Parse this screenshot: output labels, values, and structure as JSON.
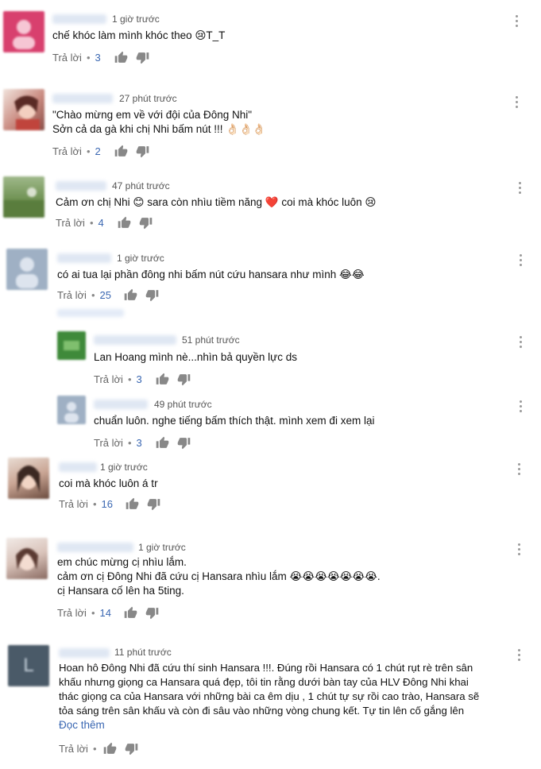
{
  "ui": {
    "reply_label": "Trả lời",
    "read_more_label": "Đọc thêm",
    "separator": "•"
  },
  "comments": [
    {
      "time": "1 giờ trước",
      "lines": [
        "chế khóc làm mình khóc theo 😢T_T"
      ],
      "likes": "3"
    },
    {
      "time": "27 phút trước",
      "lines": [
        "\"Chào mừng em về với đội của Đông Nhi\"",
        "Sởn cả da gà khi chị Nhi bấm nút !!! 👌🏻👌🏻👌🏻"
      ],
      "likes": "2"
    },
    {
      "time": "47 phút trước",
      "lines": [
        "Cảm ơn chị Nhi 😊 sara còn nhìu tiềm năng ❤️ coi mà khóc luôn 😢"
      ],
      "likes": "4"
    },
    {
      "time": "1 giờ trước",
      "lines": [
        "có ai tua lại phần đông nhi bấm nút cứu hansara như mình 😂😂"
      ],
      "likes": "25"
    },
    {
      "time": "51 phút trước",
      "lines": [
        "Lan Hoang  mình nè...nhìn bả quyền lực ds"
      ],
      "likes": "3"
    },
    {
      "time": "49 phút trước",
      "lines": [
        "chuẩn luôn. nghe tiếng bấm thích thật. mình xem đi xem lại"
      ],
      "likes": "3"
    },
    {
      "time": "1 giờ trước",
      "lines": [
        "coi mà khóc luôn á tr"
      ],
      "likes": "16"
    },
    {
      "time": "1 giờ trước",
      "lines": [
        "em chúc mừng cị nhìu lắm.",
        "cảm ơn cị Đông Nhi đã cứu cị Hansara nhìu lắm 😭😭😭😭😭😭😭.",
        "cị Hansara cố lên ha 5ting."
      ],
      "likes": "14"
    },
    {
      "time": "11 phút trước",
      "lines": [
        "Hoan hô Đông Nhi đã cứu thí sinh Hansara !!!. Đúng rồi Hansara có 1 chút rụt rè trên sân",
        "khấu nhưng giọng ca Hansara quá đẹp, tôi tin rằng dưới bàn tay của HLV Đông Nhi khai",
        "thác giọng ca của Hansara với những bài ca êm dịu , 1 chút tự sự rồi cao trào, Hansara sẽ",
        "tỏa sáng trên sân khấu và còn đi sâu vào những vòng chung kết. Tự tin lên cố gắng lên"
      ],
      "likes": "",
      "avatar_letter": "L"
    }
  ],
  "colors": {
    "link": "#3a67b2",
    "avatar_1": "#d8406e",
    "avatar_4": "#9fb0c4",
    "avatar_5": "#3f8a3a",
    "avatar_9": "#4a5a68"
  }
}
